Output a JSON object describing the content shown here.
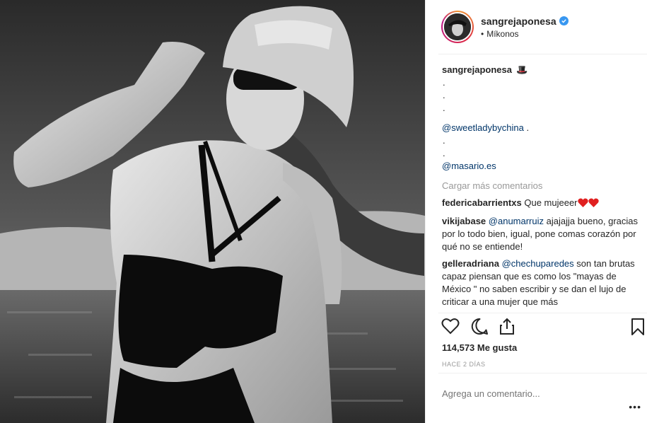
{
  "post": {
    "username": "sangrejaponesa",
    "location": "Míkonos",
    "location_dot": "•",
    "caption_emoji": "🎩",
    "caption_dots": [
      ".",
      ".",
      "."
    ],
    "mention1": "@sweetladybychina",
    "mention1_tail": " .",
    "mid_dots": [
      ".",
      "."
    ],
    "mention2": "@masario.es"
  },
  "load_more_label": "Cargar más comentarios",
  "comments": [
    {
      "user": "federicabarrientxs",
      "text": "Que mujeeer",
      "hearts": 2
    },
    {
      "user": "vikijabase",
      "mention": "@anumarruiz",
      "text": " ajajajja bueno, gracias por lo todo bien, igual, pone comas corazón por qué no se entiende!"
    },
    {
      "user": "gelleradriana",
      "mention": "@chechuparedes",
      "text": " son tan brutas capaz piensan que es como los \"mayas de México \" no saben escribir y se dan el lujo de criticar a una mujer que más"
    }
  ],
  "likes_text": "114,573 Me gusta",
  "time_text": "HACE 2 DÍAS",
  "add_comment_placeholder": "Agrega un comentario...",
  "more_label": "•••",
  "colors": {
    "verified": "#3897f0",
    "mention": "#003569",
    "muted": "#999999",
    "heart": "#ed4956"
  },
  "icons": [
    "heart-icon",
    "comment-icon",
    "share-icon",
    "bookmark-icon",
    "verified-icon",
    "avatar"
  ]
}
